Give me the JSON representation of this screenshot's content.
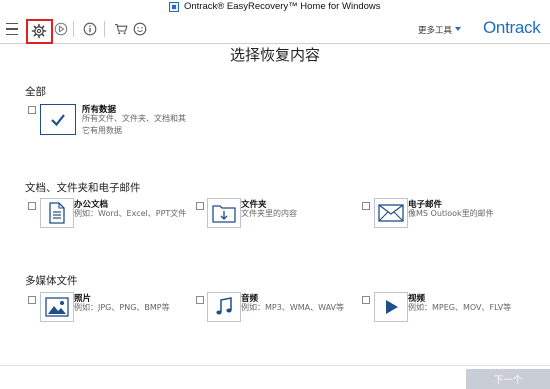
{
  "window": {
    "title": "Ontrack® EasyRecovery™ Home for Windows"
  },
  "toolbar": {
    "icons": [
      "menu-icon",
      "gear-icon",
      "play-icon",
      "info-icon",
      "cart-icon",
      "smile-icon"
    ],
    "more_tools": "更多工具",
    "brand": "Ontrack",
    "highlight_color": "#e02020",
    "brand_color": "#1f6dbf"
  },
  "main": {
    "heading": "选择恢复内容",
    "sections": [
      {
        "title": "全部",
        "options": [
          {
            "title": "所有数据",
            "desc_line1": "所有文件、文件夹、文档和其",
            "desc_line2": "它有用数据",
            "icon": "check-icon"
          }
        ]
      },
      {
        "title": "文档、文件夹和电子邮件",
        "options": [
          {
            "title": "办公文档",
            "desc": "例如：Word、Excel、PPT文件",
            "icon": "document-icon"
          },
          {
            "title": "文件夹",
            "desc": "文件夹里的内容",
            "icon": "folder-icon"
          },
          {
            "title": "电子邮件",
            "desc": "像MS Outlook里的邮件",
            "icon": "mail-icon"
          }
        ]
      },
      {
        "title": "多媒体文件",
        "options": [
          {
            "title": "照片",
            "desc": "例如：JPG、PNG、BMP等",
            "icon": "photo-icon"
          },
          {
            "title": "音频",
            "desc": "例如：MP3、WMA、WAV等",
            "icon": "music-icon"
          },
          {
            "title": "视频",
            "desc": "例如：MPEG、MOV、FLV等",
            "icon": "video-icon"
          }
        ]
      }
    ]
  },
  "footer": {
    "next_label": "下一个"
  }
}
